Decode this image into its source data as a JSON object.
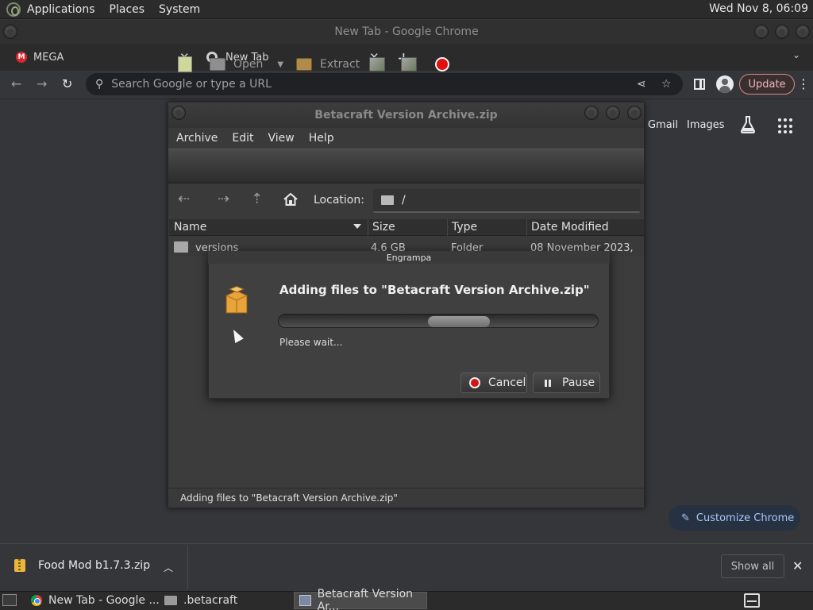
{
  "top_panel": {
    "menus": [
      "Applications",
      "Places",
      "System"
    ],
    "clock": "Wed Nov 8, 06:09"
  },
  "chrome": {
    "window_title": "New Tab - Google Chrome",
    "tabs": [
      {
        "label": "MEGA",
        "icon": "mega-icon"
      },
      {
        "label": "New Tab",
        "icon": "chrome-icon"
      }
    ],
    "omnibox_placeholder": "Search Google or type a URL",
    "update_label": "Update",
    "ntp_links": [
      "Gmail",
      "Images"
    ],
    "customize_label": "Customize Chrome"
  },
  "downloads": {
    "item_name": "Food Mod b1.7.3.zip",
    "show_all_label": "Show all"
  },
  "archive_window": {
    "title": "Betacraft Version Archive.zip",
    "menus": [
      "Archive",
      "Edit",
      "View",
      "Help"
    ],
    "toolbar": {
      "open_label": "Open",
      "extract_label": "Extract"
    },
    "location_label": "Location:",
    "location_path": "/",
    "columns": [
      "Name",
      "Size",
      "Type",
      "Date Modified"
    ],
    "rows": [
      {
        "name": "versions",
        "size": "4.6 GB",
        "type": "Folder",
        "date": "08 November 2023, ..."
      }
    ],
    "status": "Adding files to \"Betacraft Version Archive.zip\""
  },
  "dialog": {
    "title": "Engrampa",
    "heading": "Adding files to \"Betacraft Version Archive.zip\"",
    "wait_text": "Please wait...",
    "cancel_label": "Cancel",
    "pause_label": "Pause"
  },
  "taskbar": {
    "items": [
      {
        "label": "New Tab - Google ..."
      },
      {
        "label": ".betacraft"
      },
      {
        "label": "Betacraft Version Ar..."
      }
    ]
  }
}
